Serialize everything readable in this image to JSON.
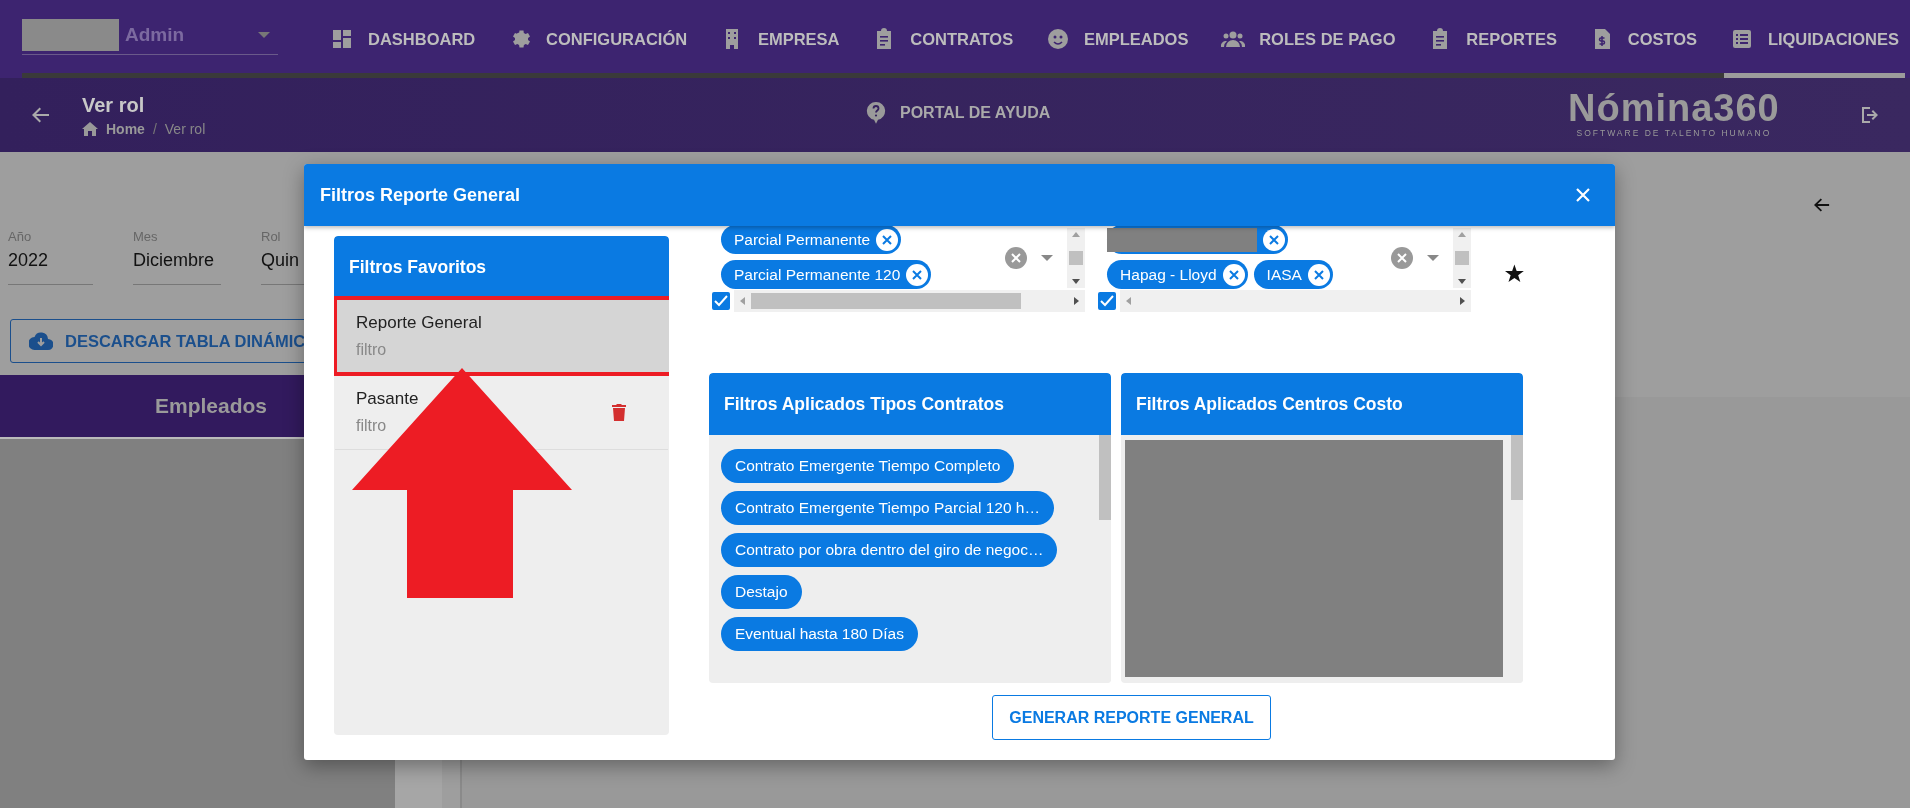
{
  "nav": {
    "user": "Admin",
    "items": [
      {
        "label": "DASHBOARD",
        "selected": false
      },
      {
        "label": "CONFIGURACIÓN",
        "selected": false
      },
      {
        "label": "EMPRESA",
        "selected": false
      },
      {
        "label": "CONTRATOS",
        "selected": false
      },
      {
        "label": "EMPLEADOS",
        "selected": false
      },
      {
        "label": "ROLES DE PAGO",
        "selected": false
      },
      {
        "label": "REPORTES",
        "selected": false
      },
      {
        "label": "COSTOS",
        "selected": false
      },
      {
        "label": "LIQUIDACIONES",
        "selected": true
      }
    ]
  },
  "header": {
    "title": "Ver rol",
    "breadcrumb": [
      "Home",
      "Ver rol"
    ],
    "separator": "/",
    "help": "PORTAL DE AYUDA",
    "logo": "Nómina360",
    "tagline": "SOFTWARE DE TALENTO HUMANO"
  },
  "form": {
    "fields": [
      {
        "label": "Año",
        "value": "2022"
      },
      {
        "label": "Mes",
        "value": "Diciembre"
      },
      {
        "label": "Rol",
        "value": "Quin"
      }
    ],
    "download": "DESCARGAR TABLA DINÁMIC",
    "panel": "Empleados"
  },
  "dialog": {
    "title": "Filtros Reporte General",
    "favorites": {
      "title": "Filtros Favoritos",
      "items": [
        {
          "name": "Reporte General",
          "subtitle": "filtro",
          "selected": true,
          "highlighted": true
        },
        {
          "name": "Pasante",
          "subtitle": "filtro",
          "selected": false,
          "highlighted": false
        }
      ]
    },
    "selects": [
      {
        "checked": true,
        "chips": [
          {
            "kind": "text",
            "label": "Parcial Permanente"
          },
          {
            "kind": "text",
            "label": "Parcial Permanente 120"
          }
        ]
      },
      {
        "checked": true,
        "chips": [
          {
            "kind": "redacted"
          },
          {
            "kind": "text",
            "label": "Hapag - Lloyd"
          },
          {
            "kind": "text",
            "label": "IASA"
          }
        ]
      }
    ],
    "applied": [
      {
        "title": "Filtros Aplicados Tipos Contratos",
        "kind": "chips",
        "chips": [
          "Contrato Emergente Tiempo Completo",
          "Contrato Emergente Tiempo Parcial 120 h…",
          "Contrato por obra dentro del giro de negoc…",
          "Destajo",
          "Eventual hasta 180 Días"
        ]
      },
      {
        "title": "Filtros Aplicados Centros Costo",
        "kind": "redacted"
      }
    ],
    "button": "GENERAR REPORTE GENERAL"
  }
}
